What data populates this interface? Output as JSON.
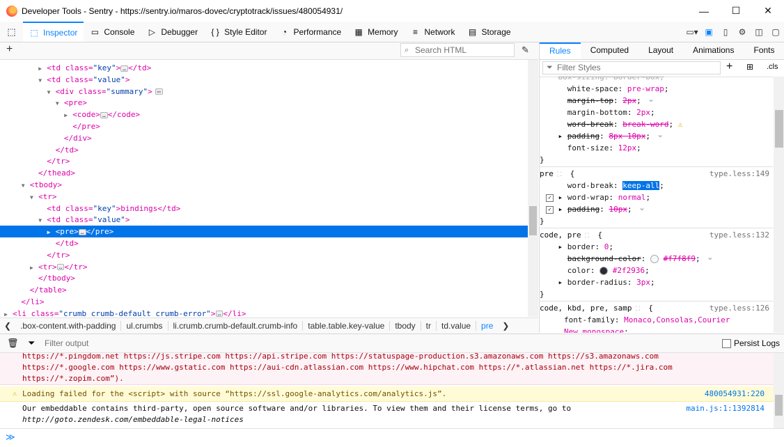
{
  "window": {
    "title": "Developer Tools - Sentry - https://sentry.io/maros-dovec/cryptotrack/issues/480054931/",
    "minimize": "—",
    "maximize": "☐",
    "close": "✕"
  },
  "toolbar": {
    "tabs": [
      {
        "label": "Inspector",
        "icon": "inspector-icon",
        "glyph": "⬚"
      },
      {
        "label": "Console",
        "icon": "console-icon",
        "glyph": "▭"
      },
      {
        "label": "Debugger",
        "icon": "debugger-icon",
        "glyph": "▷"
      },
      {
        "label": "Style Editor",
        "icon": "style-editor-icon",
        "glyph": "{ }"
      },
      {
        "label": "Performance",
        "icon": "performance-icon",
        "glyph": "◔"
      },
      {
        "label": "Memory",
        "icon": "memory-icon",
        "glyph": "▦"
      },
      {
        "label": "Network",
        "icon": "network-icon",
        "glyph": "≡"
      },
      {
        "label": "Storage",
        "icon": "storage-icon",
        "glyph": "▤"
      }
    ],
    "active_tab": "Inspector"
  },
  "markup": {
    "search_placeholder": "Search HTML",
    "lines": [
      {
        "indent": 21,
        "arrow": "▶",
        "pre": "<td ",
        "attrs": [
          [
            "class",
            "key"
          ]
        ],
        "post": ">",
        "ell": true,
        "close": "</td>"
      },
      {
        "indent": 21,
        "arrow": "▼",
        "pre": "<td ",
        "attrs": [
          [
            "class",
            "value"
          ]
        ],
        "post": ">",
        "ell": false,
        "close": ""
      },
      {
        "indent": 22,
        "arrow": "▼",
        "pre": "<div ",
        "attrs": [
          [
            "class",
            "summary"
          ]
        ],
        "post": ">",
        "ell2": true,
        "close": ""
      },
      {
        "indent": 23,
        "arrow": "▼",
        "pre": "<pre>",
        "attrs": [],
        "post": "",
        "ell": false,
        "close": ""
      },
      {
        "indent": 24,
        "arrow": "▶",
        "pre": "<code>",
        "attrs": [],
        "post": "",
        "ell": true,
        "close": "</code>"
      },
      {
        "indent": 24,
        "arrow": "",
        "pre": "</pre>",
        "attrs": [],
        "post": "",
        "ell": false,
        "close": ""
      },
      {
        "indent": 23,
        "arrow": "",
        "pre": "</div>",
        "attrs": [],
        "post": "",
        "ell": false,
        "close": ""
      },
      {
        "indent": 22,
        "arrow": "",
        "pre": "</td>",
        "attrs": [],
        "post": "",
        "ell": false,
        "close": ""
      },
      {
        "indent": 21,
        "arrow": "",
        "pre": "</tr>",
        "attrs": [],
        "post": "",
        "ell": false,
        "close": ""
      },
      {
        "indent": 20,
        "arrow": "",
        "pre": "</thead>",
        "attrs": [],
        "post": "",
        "ell": false,
        "close": ""
      },
      {
        "indent": 19,
        "arrow": "▼",
        "pre": "<tbody>",
        "attrs": [],
        "post": "",
        "ell": false,
        "close": ""
      },
      {
        "indent": 20,
        "arrow": "▼",
        "pre": "<tr>",
        "attrs": [],
        "post": "",
        "ell": false,
        "close": ""
      },
      {
        "indent": 21,
        "arrow": "",
        "pre": "<td ",
        "attrs": [
          [
            "class",
            "key"
          ]
        ],
        "post": ">bindings",
        "ell": false,
        "close": "</td>"
      },
      {
        "indent": 21,
        "arrow": "▼",
        "pre": "<td ",
        "attrs": [
          [
            "class",
            "value"
          ]
        ],
        "post": ">",
        "ell": false,
        "close": ""
      },
      {
        "indent": 22,
        "arrow": "▶",
        "pre": "<pre>",
        "attrs": [],
        "post": "",
        "ell": true,
        "close": "</pre>",
        "selected": true
      },
      {
        "indent": 22,
        "arrow": "",
        "pre": "</td>",
        "attrs": [],
        "post": "",
        "ell": false,
        "close": ""
      },
      {
        "indent": 21,
        "arrow": "",
        "pre": "</tr>",
        "attrs": [],
        "post": "",
        "ell": false,
        "close": ""
      },
      {
        "indent": 20,
        "arrow": "▶",
        "pre": "<tr>",
        "attrs": [],
        "post": "",
        "ell": true,
        "close": "</tr>"
      },
      {
        "indent": 20,
        "arrow": "",
        "pre": "</tbody>",
        "attrs": [],
        "post": "",
        "ell": false,
        "close": ""
      },
      {
        "indent": 19,
        "arrow": "",
        "pre": "</table>",
        "attrs": [],
        "post": "",
        "ell": false,
        "close": ""
      },
      {
        "indent": 18,
        "arrow": "",
        "pre": "</li>",
        "attrs": [],
        "post": "",
        "ell": false,
        "close": ""
      },
      {
        "indent": 17,
        "arrow": "▶",
        "pre": "<li ",
        "attrs": [
          [
            "class",
            "crumb crumb-default crumb-error"
          ]
        ],
        "post": ">",
        "ell": true,
        "close": "</li>"
      }
    ]
  },
  "breadcrumbs": [
    ".box-content.with-padding",
    "ul.crumbs",
    "li.crumb.crumb-default.crumb-info",
    "table.table.key-value",
    "tbody",
    "tr",
    "td.value",
    "pre"
  ],
  "sidebar": {
    "tabs": [
      "Rules",
      "Computed",
      "Layout",
      "Animations",
      "Fonts"
    ],
    "active_tab": "Rules",
    "filter_placeholder": "Filter Styles",
    "cls_label": ".cls",
    "rule1": {
      "partial_top": "box-sizing: border-box;",
      "decls": [
        {
          "name": "white-space",
          "value": "pre-wrap",
          "strike": false
        },
        {
          "name": "margin-top",
          "value": "2px",
          "strike": true
        },
        {
          "name": "margin-bottom",
          "value": "2px",
          "strike": false
        },
        {
          "name": "word-break",
          "value": "break-word",
          "strike": true,
          "warn": true
        },
        {
          "name": "padding",
          "value": "8px 10px",
          "strike": true,
          "expand": true
        },
        {
          "name": "font-size",
          "value": "12px",
          "strike": false
        }
      ]
    },
    "rule2": {
      "selector": "pre",
      "source": "type.less:149",
      "decls": [
        {
          "name": "word-break",
          "value": "keep-all"
        },
        {
          "name": "word-wrap",
          "value": "normal"
        },
        {
          "name": "padding",
          "value": "10px"
        }
      ]
    },
    "rule3": {
      "selector": "code, pre",
      "source": "type.less:132",
      "decls": [
        {
          "name": "border",
          "value": "0"
        },
        {
          "name": "background-color",
          "value": "#f7f8f9"
        },
        {
          "name": "color",
          "value": "#2f2936"
        },
        {
          "name": "border-radius",
          "value": "3px"
        }
      ]
    },
    "rule4": {
      "selector": "code, kbd, pre, samp",
      "source": "type.less:126",
      "decls": [
        {
          "name": "font-family",
          "value": "Monaco,Consolas,Courier New,monospace"
        }
      ]
    }
  },
  "console": {
    "filter_placeholder": "Filter output",
    "persist_logs": "Persist Logs",
    "messages": [
      {
        "type": "error",
        "lines": [
          "https://*.pingdom.net https://js.stripe.com https://api.stripe.com https://statuspage-production.s3.amazonaws.com https://s3.amazonaws.com",
          "https://*.google.com https://www.gstatic.com https://aui-cdn.atlassian.com https://www.hipchat.com https://*.atlassian.net https://*.jira.com",
          "https://*.zopim.com”)."
        ]
      },
      {
        "type": "warning",
        "text": "Loading failed for the <script> with source “https://ssl.google-analytics.com/analytics.js”.",
        "location": "480054931:220"
      },
      {
        "type": "log",
        "text": "Our embeddable contains third-party, open source software and/or libraries. To view them and their license terms, go to",
        "url": "http://goto.zendesk.com/embeddable-legal-notices",
        "location": "main.js:1:1392814"
      }
    ]
  },
  "colors": {
    "accent": "#0a84ff",
    "selection": "#0074e8",
    "tag": "#dd00a9",
    "attrval": "#003eaa"
  }
}
